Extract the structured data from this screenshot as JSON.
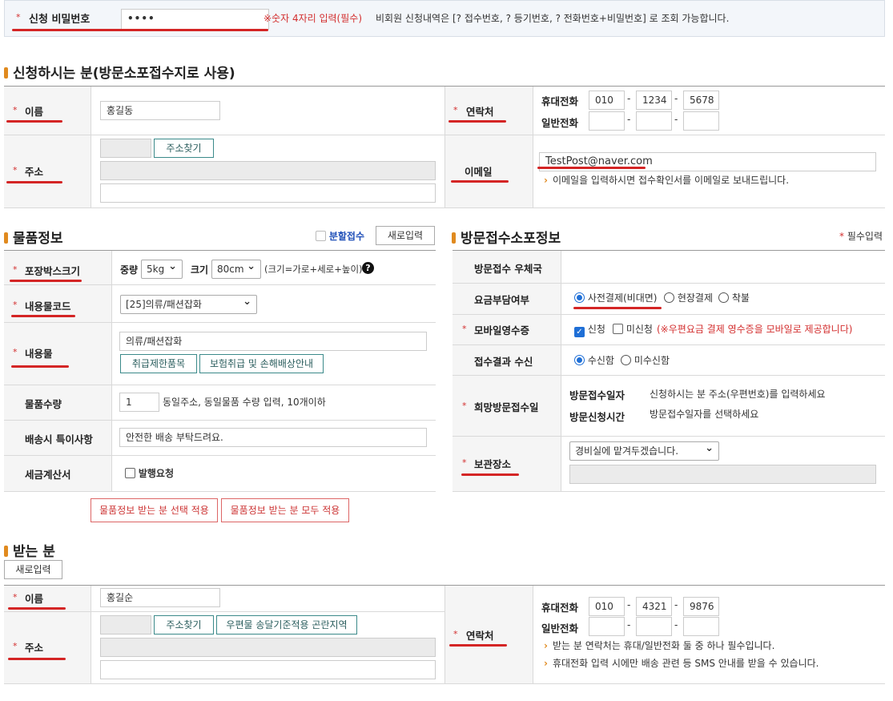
{
  "password_bar": {
    "label": "신청 비밀번호",
    "value": "••••",
    "notice_red": "※숫자 4자리 입력(필수)",
    "notice": "비회원 신청내역은 [? 접수번호, ? 등기번호, ? 전화번호+비밀번호] 로 조회 가능합니다."
  },
  "sender": {
    "title": "신청하시는 분(방문소포접수지로 사용)",
    "name_label": "이름",
    "name_value": "홍길동",
    "address_label": "주소",
    "find_address": "주소찾기",
    "contact_label": "연락처",
    "mobile_label": "휴대전화",
    "mobile": [
      "010",
      "1234",
      "5678"
    ],
    "phone_label": "일반전화",
    "dash": "-",
    "email_label": "이메일",
    "email_value": "TestPost@naver.com",
    "email_note": "이메일을 입력하시면 접수확인서를 이메일로 보내드립니다."
  },
  "goods": {
    "title": "물품정보",
    "split_label": "분할접수",
    "new_input": "새로입력",
    "box_label": "포장박스크기",
    "weight_label": "중량",
    "weight_value": "5kg",
    "size_label": "크기",
    "size_value": "80cm",
    "size_hint": "(크기=가로+세로+높이)",
    "help": "?",
    "code_label": "내용물코드",
    "code_value": "[25]의류/패션잡화",
    "content_label": "내용물",
    "content_value": "의류/패션잡화",
    "restrict_btn": "취급제한품목",
    "insure_btn": "보험취급 및 손해배상안내",
    "qty_label": "물품수량",
    "qty_value": "1",
    "qty_hint": "동일주소, 동일물품 수량 입력, 10개이하",
    "special_label": "배송시 특이사항",
    "special_value": "안전한 배송 부탁드려요.",
    "tax_label": "세금계산서",
    "tax_check": "발행요청",
    "apply_selected": "물품정보 받는 분 선택 적용",
    "apply_all": "물품정보 받는 분 모두 적용"
  },
  "visit": {
    "title": "방문접수소포정보",
    "required": "필수입력",
    "office_label": "방문접수 우체국",
    "fee_label": "요금부담여부",
    "fee_options": [
      "사전결제(비대면)",
      "현장결제",
      "착불"
    ],
    "receipt_label": "모바일영수증",
    "receipt_apply": "신청",
    "receipt_no": "미신청",
    "receipt_note": "(※우편요금 결제 영수증을 모바일로 제공합니다)",
    "result_label": "접수결과 수신",
    "result_yes": "수신함",
    "result_no": "미수신함",
    "date_label": "희망방문접수일",
    "date_k1": "방문접수일자",
    "date_v1": "신청하시는 분 주소(우편번호)를 입력하세요",
    "date_k2": "방문신청시간",
    "date_v2": "방문접수일자를 선택하세요",
    "storage_label": "보관장소",
    "storage_value": "경비실에 맡겨두겠습니다."
  },
  "receiver": {
    "title": "받는 분",
    "new_input": "새로입력",
    "name_label": "이름",
    "name_value": "홍길순",
    "address_label": "주소",
    "find_address": "주소찾기",
    "hard_area": "우편물 송달기준적용 곤란지역",
    "contact_label": "연락처",
    "mobile_label": "휴대전화",
    "mobile": [
      "010",
      "4321",
      "9876"
    ],
    "phone_label": "일반전화",
    "dash": "-",
    "note1": "받는 분 연락처는 휴대/일반전화 둘 중 하나 필수입니다.",
    "note2": "휴대전화 입력 시에만 배송 관련 등 SMS 안내를 받을 수 있습니다."
  },
  "colors": {
    "accent_red": "#d42525",
    "section_bar": "#e08a1f",
    "teal_button": "#3b8a8a"
  }
}
